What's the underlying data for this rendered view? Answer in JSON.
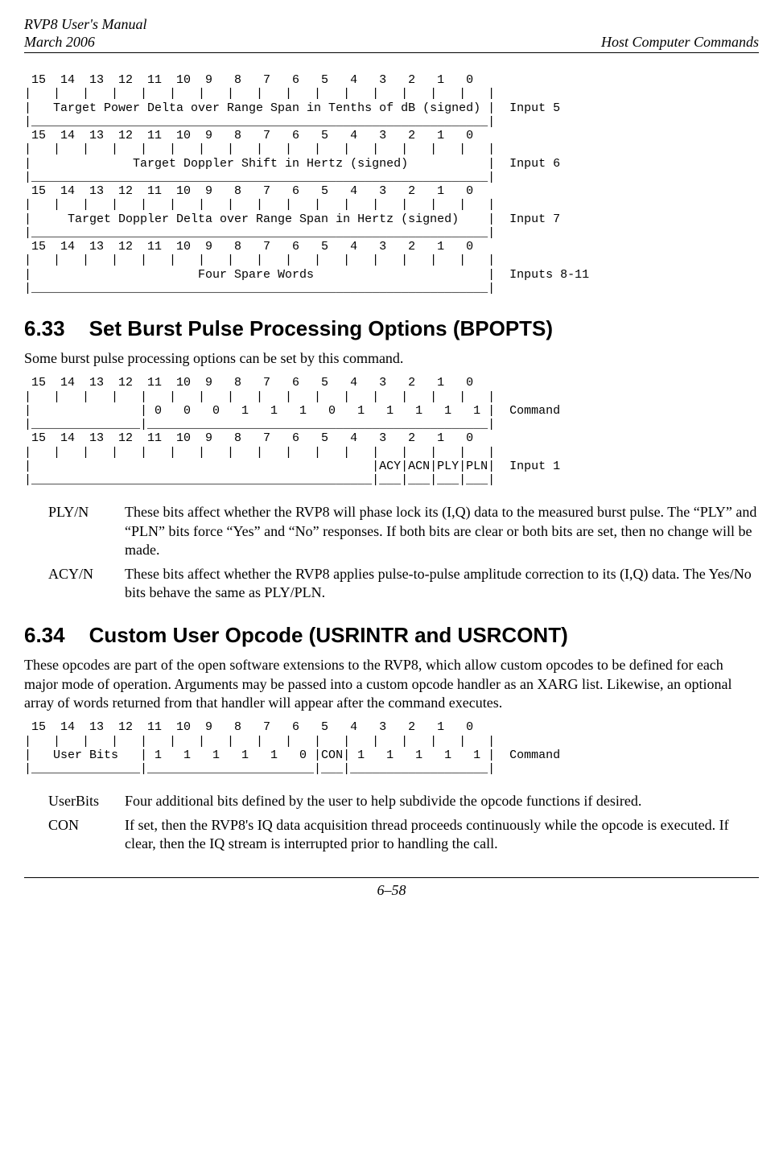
{
  "header": {
    "left_line1": "RVP8 User's Manual",
    "left_line2": "March 2006",
    "right_line1": "Host Computer Commands"
  },
  "diagrams": {
    "top": " 15  14  13  12  11  10  9   8   7   6   5   4   3   2   1   0 \n|   |   |   |   |   |   |   |   |   |   |   |   |   |   |   |   |\n|   Target Power Delta over Range Span in Tenths of dB (signed) |  Input 5\n|_______________________________________________________________|\n 15  14  13  12  11  10  9   8   7   6   5   4   3   2   1   0 \n|   |   |   |   |   |   |   |   |   |   |   |   |   |   |   |   |\n|              Target Doppler Shift in Hertz (signed)           |  Input 6\n|_______________________________________________________________|\n 15  14  13  12  11  10  9   8   7   6   5   4   3   2   1   0 \n|   |   |   |   |   |   |   |   |   |   |   |   |   |   |   |   |\n|     Target Doppler Delta over Range Span in Hertz (signed)    |  Input 7\n|_______________________________________________________________|\n 15  14  13  12  11  10  9   8   7   6   5   4   3   2   1   0 \n|   |   |   |   |   |   |   |   |   |   |   |   |   |   |   |   |\n|                       Four Spare Words                        |  Inputs 8-11\n|_______________________________________________________________|",
    "bpopts": " 15  14  13  12  11  10  9   8   7   6   5   4   3   2   1   0 \n|   |   |   |   |   |   |   |   |   |   |   |   |   |   |   |   |\n|               | 0   0   0   1   1   1   0   1   1   1   1   1 |  Command\n|_______________|_______________________________________________|\n 15  14  13  12  11  10  9   8   7   6   5   4   3   2   1   0 \n|   |   |   |   |   |   |   |   |   |   |   |   |   |   |   |   |\n|                                               |ACY|ACN|PLY|PLN|  Input 1\n|_______________________________________________|___|___|___|___|",
    "usr": " 15  14  13  12  11  10  9   8   7   6   5   4   3   2   1   0 \n|   |   |   |   |   |   |   |   |   |   |   |   |   |   |   |   |\n|   User Bits   | 1   1   1   1   1   0 |CON| 1   1   1   1   1 |  Command\n|_______________|_______________________|___|___________________|"
  },
  "section633": {
    "num": "6.33",
    "title": "Set Burst Pulse Processing Options (BPOPTS)",
    "intro": "Some burst pulse processing options can be set by this command.",
    "defs": [
      {
        "term": "PLY/N",
        "body": "These bits affect whether the RVP8 will phase lock its (I,Q) data to the measured burst pulse.  The “PLY” and “PLN” bits force “Yes” and “No” responses.  If both bits are clear or both bits are set, then no change will be made."
      },
      {
        "term": "ACY/N",
        "body": "These bits affect whether the RVP8 applies pulse-to-pulse amplitude correction to its (I,Q) data.  The Yes/No bits behave the same as PLY/PLN."
      }
    ]
  },
  "section634": {
    "num": "6.34",
    "title": "Custom User Opcode (USRINTR and USRCONT)",
    "intro": "These opcodes are part of the open software extensions to the RVP8, which allow custom opcodes to be defined for each major mode of operation.  Arguments may be passed into a custom opcode handler as an XARG list.  Likewise, an optional array of words returned from that handler will appear after the command executes.",
    "defs": [
      {
        "term": "UserBits",
        "body": "Four additional bits defined by the user to help subdivide the opcode functions if desired."
      },
      {
        "term": "CON",
        "body": "If set, then the RVP8's IQ data acquisition thread proceeds continuously while the opcode is executed.  If clear, then the IQ stream is interrupted prior to handling the call."
      }
    ]
  },
  "footer": {
    "page": "6–58"
  }
}
